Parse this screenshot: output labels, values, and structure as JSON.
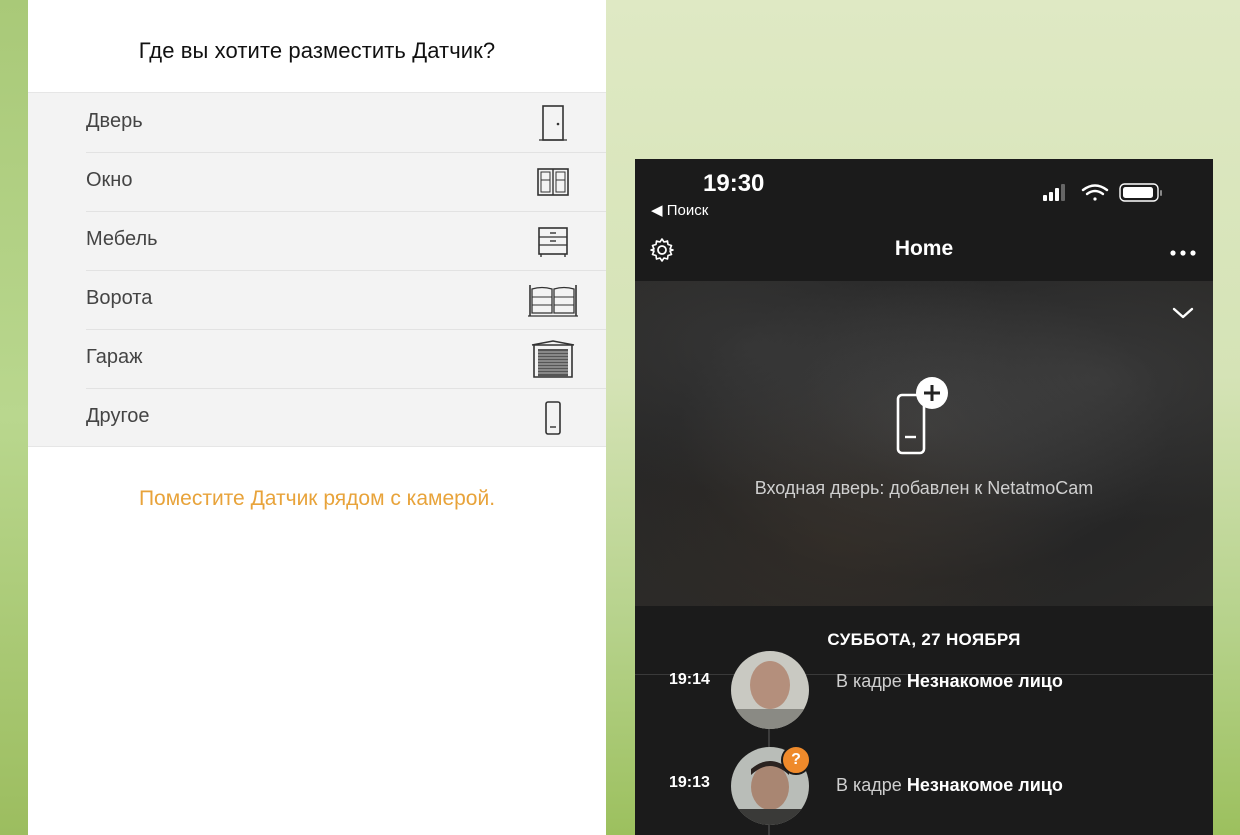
{
  "left_panel": {
    "title": "Где вы хотите разместить Датчик?",
    "options": [
      {
        "label": "Дверь",
        "icon": "door-icon"
      },
      {
        "label": "Окно",
        "icon": "window-icon"
      },
      {
        "label": "Мебель",
        "icon": "furniture-icon"
      },
      {
        "label": "Ворота",
        "icon": "gate-icon"
      },
      {
        "label": "Гараж",
        "icon": "garage-icon"
      },
      {
        "label": "Другое",
        "icon": "sensor-icon"
      }
    ],
    "hint": "Поместите Датчик рядом с камерой.",
    "hint_color": "#e8a33a"
  },
  "phone": {
    "status_time": "19:30",
    "back_label": "◀ Поиск",
    "header_title": "Home",
    "camera_message": "Входная дверь: добавлен к NetatmoCam",
    "date_header": "СУББОТА, 27 НОЯБРЯ",
    "events": [
      {
        "time": "19:14",
        "prefix": "В кадре ",
        "name": "Незнакомое лицо"
      },
      {
        "time": "19:13",
        "prefix": "В кадре ",
        "name": "Незнакомое лицо",
        "badge": "?"
      }
    ],
    "badge_color": "#ef8a2b"
  }
}
